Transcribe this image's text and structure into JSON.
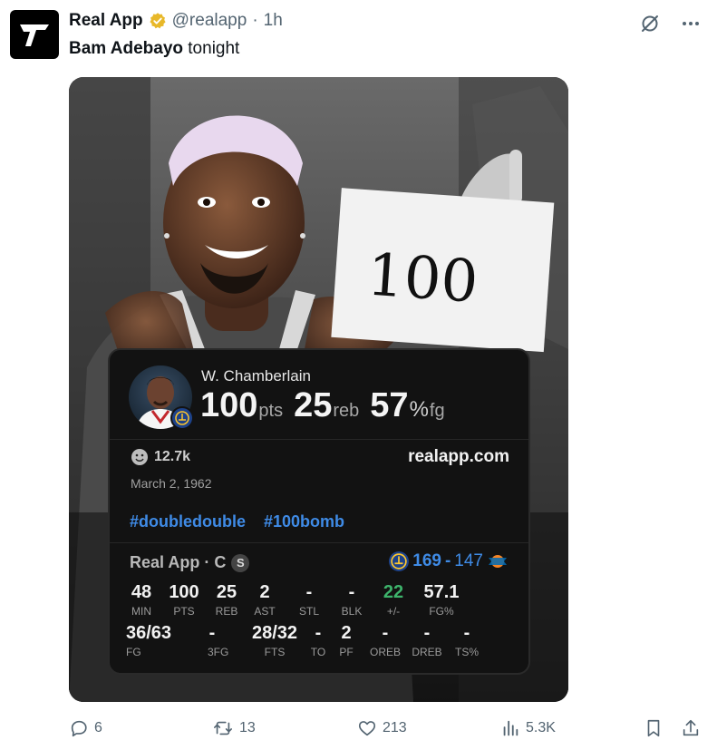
{
  "post": {
    "author_name": "Real App",
    "handle": "@realapp",
    "separator": "·",
    "time": "1h",
    "text_bold": "Bam Adebayo",
    "text_rest": " tonight"
  },
  "card": {
    "player_name": "W. Chamberlain",
    "pts": "100",
    "pts_unit": "pts",
    "reb": "25",
    "reb_unit": "reb",
    "fg_pct": "57",
    "fg_unit_pct": "%",
    "fg_unit": "fg",
    "reactions": "12.7k",
    "site": "realapp.com",
    "date": "March 2, 1962",
    "tags": [
      "#doubledouble",
      "#100bomb"
    ],
    "line_label": "Real App · C",
    "line_badge": "S",
    "score_win": "169",
    "score_dash": "-",
    "score_loss": "147",
    "row1": [
      {
        "v": "48",
        "k": "MIN"
      },
      {
        "v": "100",
        "k": "PTS"
      },
      {
        "v": "25",
        "k": "REB"
      },
      {
        "v": "2",
        "k": "AST"
      },
      {
        "v": "-",
        "k": "STL"
      },
      {
        "v": "-",
        "k": "BLK"
      },
      {
        "v": "22",
        "k": "+/-"
      },
      {
        "v": "57.1",
        "k": "FG%"
      }
    ],
    "row2": [
      {
        "v": "36/63",
        "k": "FG"
      },
      {
        "v": "-",
        "k": "3FG"
      },
      {
        "v": "28/32",
        "k": "FTS"
      },
      {
        "v": "-",
        "k": "TO"
      },
      {
        "v": "2",
        "k": "PF"
      },
      {
        "v": "-",
        "k": "OREB"
      },
      {
        "v": "-",
        "k": "DREB"
      },
      {
        "v": "-",
        "k": "TS%"
      }
    ],
    "sign_text": "100"
  },
  "actions": {
    "replies": "6",
    "reposts": "13",
    "likes": "213",
    "views": "5.3K"
  },
  "colors": {
    "accent_blue": "#3f8be6",
    "positive_green": "#3db36b",
    "verified_gold": "#e8b829"
  }
}
